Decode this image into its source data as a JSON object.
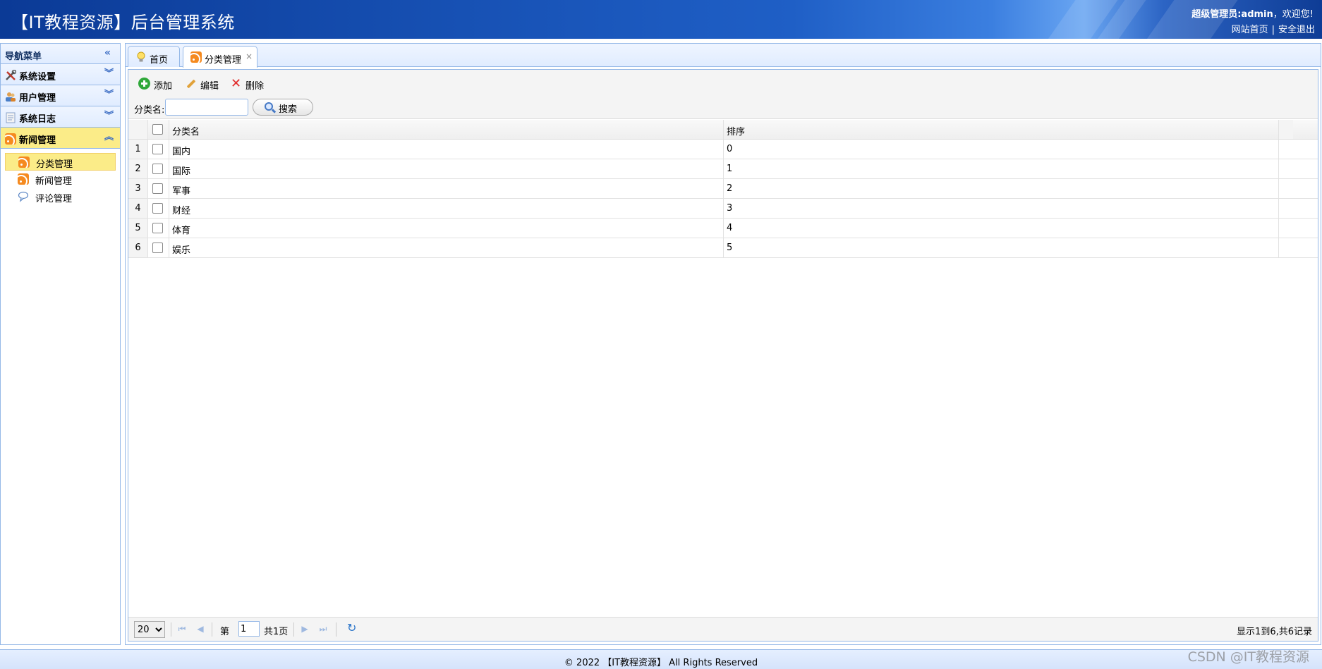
{
  "header": {
    "title": "【IT教程资源】后台管理系统",
    "user_role": "超级管理员:admin",
    "user_greeting": "，欢迎您!",
    "link_home": "网站首页",
    "link_sep": "|",
    "link_logout": "安全退出"
  },
  "nav": {
    "title": "导航菜单",
    "sections": [
      {
        "label": "系统设置"
      },
      {
        "label": "用户管理"
      },
      {
        "label": "系统日志"
      },
      {
        "label": "新闻管理"
      }
    ],
    "sub_items": [
      {
        "label": "分类管理"
      },
      {
        "label": "新闻管理"
      },
      {
        "label": "评论管理"
      }
    ]
  },
  "tabs": [
    {
      "label": "首页"
    },
    {
      "label": "分类管理",
      "close": "×"
    }
  ],
  "toolbar": {
    "add_label": "添加",
    "edit_label": "编辑",
    "delete_label": "删除",
    "search_field_label": "分类名:",
    "search_value": "",
    "search_button": "搜索"
  },
  "grid": {
    "columns": [
      "分类名",
      "排序"
    ],
    "rows": [
      {
        "n": "1",
        "name": "国内",
        "sort": "0"
      },
      {
        "n": "2",
        "name": "国际",
        "sort": "1"
      },
      {
        "n": "3",
        "name": "军事",
        "sort": "2"
      },
      {
        "n": "4",
        "name": "财经",
        "sort": "3"
      },
      {
        "n": "5",
        "name": "体育",
        "sort": "4"
      },
      {
        "n": "6",
        "name": "娱乐",
        "sort": "5"
      }
    ]
  },
  "pager": {
    "page_size": "20",
    "page_prefix": "第",
    "current_page": "1",
    "page_total": "共1页",
    "info": "显示1到6,共6记录"
  },
  "footer": {
    "text": "© 2022 【IT教程资源】 All Rights Reserved"
  },
  "watermark": "CSDN @IT教程资源",
  "colors": {
    "header_blue": "#1751b4",
    "border_blue": "#95b8e7",
    "selected_yellow": "#fbec88",
    "rss_orange": "#f58a1f"
  }
}
